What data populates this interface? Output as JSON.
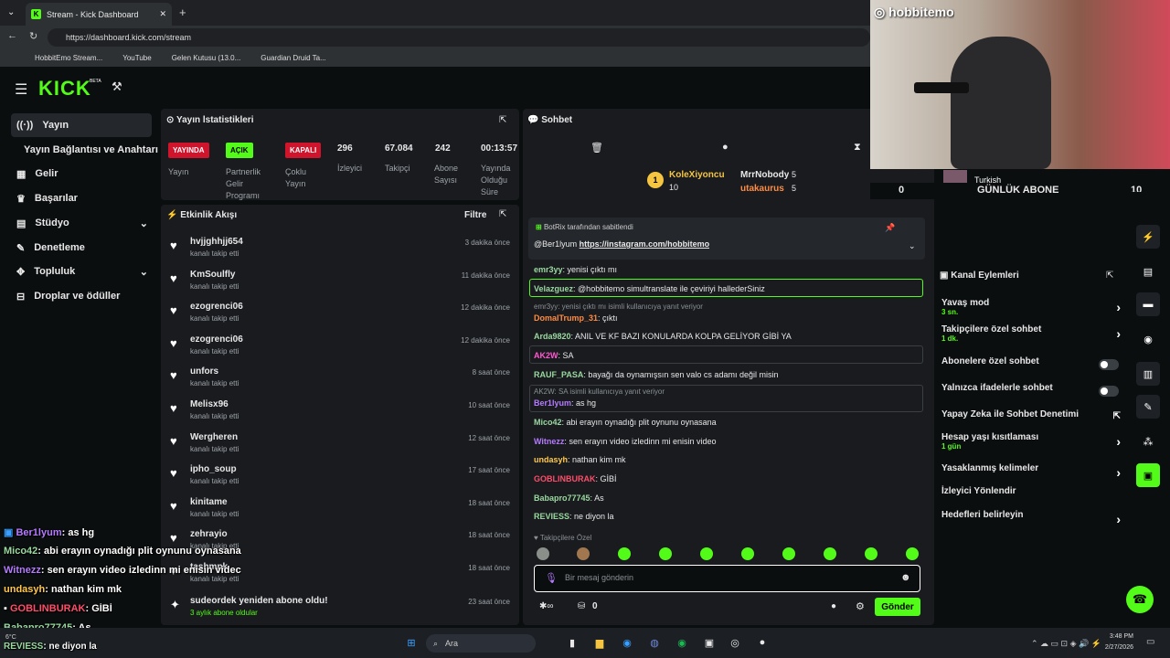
{
  "browser": {
    "tab_title": "Stream - Kick Dashboard",
    "url": "https://dashboard.kick.com/stream",
    "bookmarks": [
      "HobbitEmo Stream...",
      "YouTube",
      "Gelen Kutusu (13.0...",
      "Guardian Druid Ta..."
    ]
  },
  "logo": "KICK",
  "logo_sup": "BETA",
  "sidebar": [
    "Yayın",
    "Yayın Bağlantısı ve Anahtarı",
    "Gelir",
    "Başarılar",
    "Stüdyo",
    "Denetleme",
    "Topluluk",
    "Droplar ve ödüller"
  ],
  "stats": {
    "title": "Yayın İstatistikleri",
    "badges": [
      "YAYINDA",
      "AÇIK",
      "KAPALI"
    ],
    "badge_labels": [
      "Yayın",
      "Partnerlik Gelir Programı",
      "Çoklu Yayın"
    ],
    "values": [
      "296",
      "67.084",
      "242",
      "00:13:57"
    ],
    "labels": [
      "İzleyici",
      "Takipçi",
      "Abone Sayısı",
      "Yayında Olduğu Süre"
    ]
  },
  "activity": {
    "title": "Etkinlik Akışı",
    "filter": "Filtre",
    "sub": "kanalı takip etti",
    "items": [
      {
        "name": "hvjjghhjj654",
        "time": "3 dakika önce"
      },
      {
        "name": "KmSoulfly",
        "time": "11 dakika önce"
      },
      {
        "name": "ezogrenci06",
        "time": "12 dakika önce"
      },
      {
        "name": "ezogrenci06",
        "time": "12 dakika önce"
      },
      {
        "name": "unfors",
        "time": "8 saat önce"
      },
      {
        "name": "Melisx96",
        "time": "10 saat önce"
      },
      {
        "name": "Wergheren",
        "time": "12 saat önce"
      },
      {
        "name": "ipho_soup",
        "time": "17 saat önce"
      },
      {
        "name": "kinitame",
        "time": "18 saat önce"
      },
      {
        "name": "zehrayio",
        "time": "18 saat önce"
      },
      {
        "name": "tashmnk",
        "time": "18 saat önce"
      }
    ],
    "resub": {
      "name": "sudeordek yeniden abone oldu!",
      "sub": "3 aylık abone oldular",
      "time": "23 saat önce"
    }
  },
  "chat": {
    "title": "Sohbet",
    "leaders": {
      "first": "KoleXiyoncu",
      "first_n": "10",
      "second": "MrrNobody",
      "second_n": "5",
      "third": "utakaurus",
      "third_n": "5"
    },
    "pinned_by": "BotRix tarafından sabitlendi",
    "pinned_user": "@Ber1lyum",
    "pinned_link": "https://instagram.com/hobbitemo",
    "messages": [
      {
        "u": "emr3yy",
        "t": "yenisi çıktı mı",
        "c": "#9ad8a0"
      },
      {
        "u": "Velazguez",
        "t": "@hobbitemo simultranslate ile çeviriyi hallederSiniz",
        "c": "#9ad8a0"
      },
      {
        "u": "DomalTrump_31",
        "t": "çıktı",
        "c": "#ff8c42"
      },
      {
        "u": "Arda9820",
        "t": "ANIL VE KF BAZI KONULARDA KOLPA GELİYOR GİBİ YA",
        "c": "#9ad8a0"
      },
      {
        "u": "AK2W",
        "t": "SA",
        "c": "#ff5ad1"
      },
      {
        "u": "RAUF_PASA",
        "t": "bayağı da oynamışsın sen valo cs adamı değil misin",
        "c": "#9ad8a0"
      },
      {
        "u": "Ber1lyum",
        "t": "as hg",
        "c": "#b57bff"
      },
      {
        "u": "Mico42",
        "t": "abi erayın oynadığı plit oynunu oynasana",
        "c": "#9ad8a0"
      },
      {
        "u": "Witnezz",
        "t": "sen erayın video izledinn mi enisin video",
        "c": "#b57bff"
      },
      {
        "u": "undasyh",
        "t": "nathan kim mk",
        "c": "#ffc94d"
      },
      {
        "u": "GOBLINBURAK",
        "t": "GİBİ",
        "c": "#ff4d6a"
      },
      {
        "u": "Babapro77745",
        "t": "As",
        "c": "#9ad8a0"
      },
      {
        "u": "REVIESS",
        "t": "ne diyon la",
        "c": "#9ad8a0"
      }
    ],
    "reply1": "emr3yy: yenisi çıktı mı isimli kullanıcıya yanıt veriyor",
    "reply2": "AK2W: SA isimli kullanıcıya yanıt veriyor",
    "followers_only": "Takipçilere Özel",
    "placeholder": "Bir mesaj gönderin",
    "send": "Gönder",
    "count": "0"
  },
  "cam": {
    "ig": "hobbitemo",
    "lang": "Turkish",
    "goal": "GÜNLÜK ABONE",
    "left": "0",
    "right": "10"
  },
  "actions": {
    "title": "Kanal Eylemleri",
    "items": [
      {
        "l": "Yavaş mod",
        "s": "3 sn."
      },
      {
        "l": "Takipçilere özel sohbet",
        "s": "1 dk."
      },
      {
        "l": "Abonelere özel sohbet",
        "s": ""
      },
      {
        "l": "Yalnızca ifadelerle sohbet",
        "s": ""
      },
      {
        "l": "Yapay Zeka ile Sohbet Denetimi",
        "s": ""
      },
      {
        "l": "Hesap yaşı kısıtlaması",
        "s": "1 gün"
      },
      {
        "l": "Yasaklanmış kelimeler",
        "s": ""
      },
      {
        "l": "İzleyici Yönlendir",
        "s": ""
      },
      {
        "l": "Hedefleri belirleyin",
        "s": ""
      }
    ]
  },
  "overlay": [
    {
      "u": "Ber1lyum",
      "t": ": as hg",
      "c": "#b57bff"
    },
    {
      "u": "Mico42",
      "t": ": abi erayın oynadığı plit oynunu oynasana",
      "c": "#9ad8a0"
    },
    {
      "u": "Witnezz",
      "t": ": sen erayın video izledinn mi enisin videc",
      "c": "#b57bff"
    },
    {
      "u": "undasyh",
      "t": ": nathan kim mk",
      "c": "#ffc94d"
    },
    {
      "u": "GOBLINBURAK",
      "t": ": GİBİ",
      "c": "#ff4d6a"
    },
    {
      "u": "Babapro77745",
      "t": ": As",
      "c": "#9ad8a0"
    },
    {
      "u": "REVIESS",
      "t": ": ne diyon la",
      "c": "#9ad8a0"
    }
  ],
  "taskbar": {
    "search": "Ara",
    "time": "3:48 PM",
    "date": "2/27/2026",
    "temp": "6°C"
  }
}
